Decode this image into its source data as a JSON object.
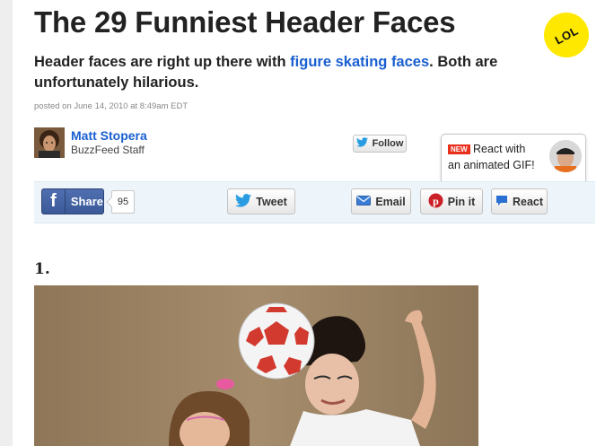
{
  "article": {
    "title": "The 29 Funniest Header Faces",
    "subtitle_prefix": "Header faces are right up there with ",
    "subtitle_link": "figure skating faces",
    "subtitle_suffix": ". Both are unfortunately hilarious.",
    "posted": "posted on June 14, 2010 at 8:49am EDT",
    "badge": "LOL"
  },
  "author": {
    "name": "Matt Stopera",
    "role": "BuzzFeed Staff",
    "follow_label": "Follow"
  },
  "react_popup": {
    "new_badge": "NEW",
    "line1": "React with",
    "line2": "an animated GIF!"
  },
  "share": {
    "facebook_label": "Share",
    "facebook_count": "95",
    "tweet_label": "Tweet",
    "email_label": "Email",
    "pin_label": "Pin it",
    "react_label": "React"
  },
  "list": {
    "item_number": "1."
  },
  "colors": {
    "link": "#1a5fd1",
    "facebook": "#3b5998",
    "twitter": "#2a9de2",
    "pinterest": "#cb2027",
    "badge": "#ffe800",
    "share_strip": "#eef5fa"
  },
  "icons": [
    "f-logo-icon",
    "twitter-bird-icon",
    "envelope-icon",
    "pinterest-icon",
    "speech-bubble-icon"
  ]
}
